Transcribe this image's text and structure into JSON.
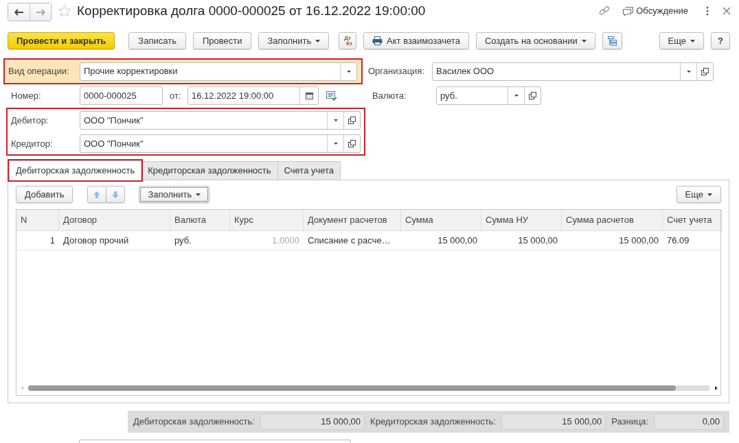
{
  "window": {
    "title": "Корректировка долга 0000-000025 от 16.12.2022 19:00:00",
    "favorite": false,
    "discussion": "Обсуждение"
  },
  "toolbar": [
    {
      "kind": "primary",
      "label": "Провести и закрыть"
    },
    {
      "kind": "plain",
      "label": "Записать"
    },
    {
      "kind": "plain",
      "label": "Провести"
    },
    {
      "kind": "dropdown",
      "label": "Заполнить"
    },
    {
      "kind": "dtkt",
      "label": "Дт",
      "label_2": "Кт"
    },
    {
      "kind": "print",
      "label": "Акт взаимозачета"
    },
    {
      "kind": "dropdown",
      "label": "Создать на основании"
    },
    {
      "kind": "structure"
    },
    {
      "kind": "more",
      "label": "Еще"
    },
    {
      "kind": "plain",
      "label": "?"
    }
  ],
  "operation": {
    "label": "Вид операции:",
    "value": "Прочие корректировки",
    "highlighted": true
  },
  "organization": {
    "label": "Организация:",
    "value": "Василек ООО"
  },
  "number": {
    "label": "Номер:",
    "value": "0000-000025"
  },
  "date": {
    "label": "от:",
    "value": "16.12.2022 19:00:00"
  },
  "currency": {
    "label": "Валюта:",
    "value": "руб."
  },
  "counterparties": {
    "highlighted": true,
    "debtor": {
      "label": "Дебитор:",
      "value": "ООО \"Пончик\""
    },
    "creditor": {
      "label": "Кредитор:",
      "value": "ООО \"Пончик\""
    }
  },
  "tabs": [
    {
      "label": "Дебиторская задолженность",
      "selected": true,
      "highlighted": true
    },
    {
      "label": "Кредиторская задолженность",
      "selected": false,
      "highlighted": false
    },
    {
      "label": "Счета учета",
      "selected": false,
      "highlighted": false
    }
  ],
  "table_toolbar": {
    "add": "Добавить",
    "fill": "Заполнить",
    "more": "Еще"
  },
  "table": {
    "columns": [
      {
        "title": "N",
        "kind": "number"
      },
      {
        "title": "Договор",
        "kind": "text"
      },
      {
        "title": "Валюта",
        "kind": "text"
      },
      {
        "title": "Курс",
        "kind": "rate"
      },
      {
        "title": "Документ расчетов",
        "kind": "text"
      },
      {
        "title": "Сумма",
        "kind": "number"
      },
      {
        "title": "Сумма НУ",
        "kind": "number"
      },
      {
        "title": "Сумма расчетов",
        "kind": "number"
      },
      {
        "title": "Счет учета",
        "kind": "text"
      }
    ],
    "rows": [
      [
        "1",
        "Договор прочий",
        "руб.",
        "1,0000",
        "Списание с расче…",
        "15 000,00",
        "15 000,00",
        "15 000,00",
        "76.09"
      ]
    ]
  },
  "totals": [
    {
      "label": "Дебиторская задолженность:",
      "value": "15 000,00"
    },
    {
      "label": "Кредиторская задолженность:",
      "value": "15 000,00"
    },
    {
      "label": "Разница:",
      "value": "0,00"
    }
  ]
}
